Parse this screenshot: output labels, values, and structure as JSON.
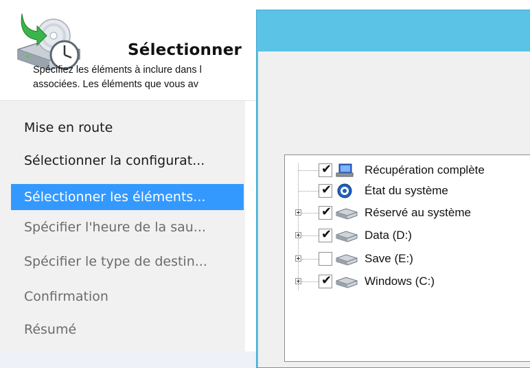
{
  "wizard": {
    "title": "Sélectionner",
    "nav": [
      {
        "label": "Mise en route",
        "state": "done"
      },
      {
        "label": "Sélectionner la configurat...",
        "state": "done"
      },
      {
        "label": "Sélectionner les éléments...",
        "state": "active"
      },
      {
        "label": "Spécifier l'heure de la sau...",
        "state": "todo"
      },
      {
        "label": "Spécifier le type de destin...",
        "state": "todo"
      },
      {
        "label": "Confirmation",
        "state": "todo"
      },
      {
        "label": "Résumé",
        "state": "todo"
      }
    ]
  },
  "dialog": {
    "description_line1": "Spécifiez les éléments à inclure dans l",
    "description_line2": "associées. Les éléments que vous av",
    "items": [
      {
        "label": "Récupération complète",
        "checked": true,
        "expandable": false,
        "icon": "bare-metal-recovery-icon"
      },
      {
        "label": "État du système",
        "checked": true,
        "expandable": false,
        "icon": "system-state-icon"
      },
      {
        "label": "Réservé au système",
        "checked": true,
        "expandable": true,
        "icon": "drive-icon"
      },
      {
        "label": "Data (D:)",
        "checked": true,
        "expandable": true,
        "icon": "drive-icon"
      },
      {
        "label": "Save (E:)",
        "checked": false,
        "expandable": true,
        "icon": "drive-icon"
      },
      {
        "label": "Windows (C:)",
        "checked": true,
        "expandable": true,
        "icon": "drive-icon"
      }
    ]
  },
  "colors": {
    "dialog_frame": "#5bc4e6",
    "nav_active": "#3399ff",
    "nav_panel": "#f1f1f1"
  }
}
